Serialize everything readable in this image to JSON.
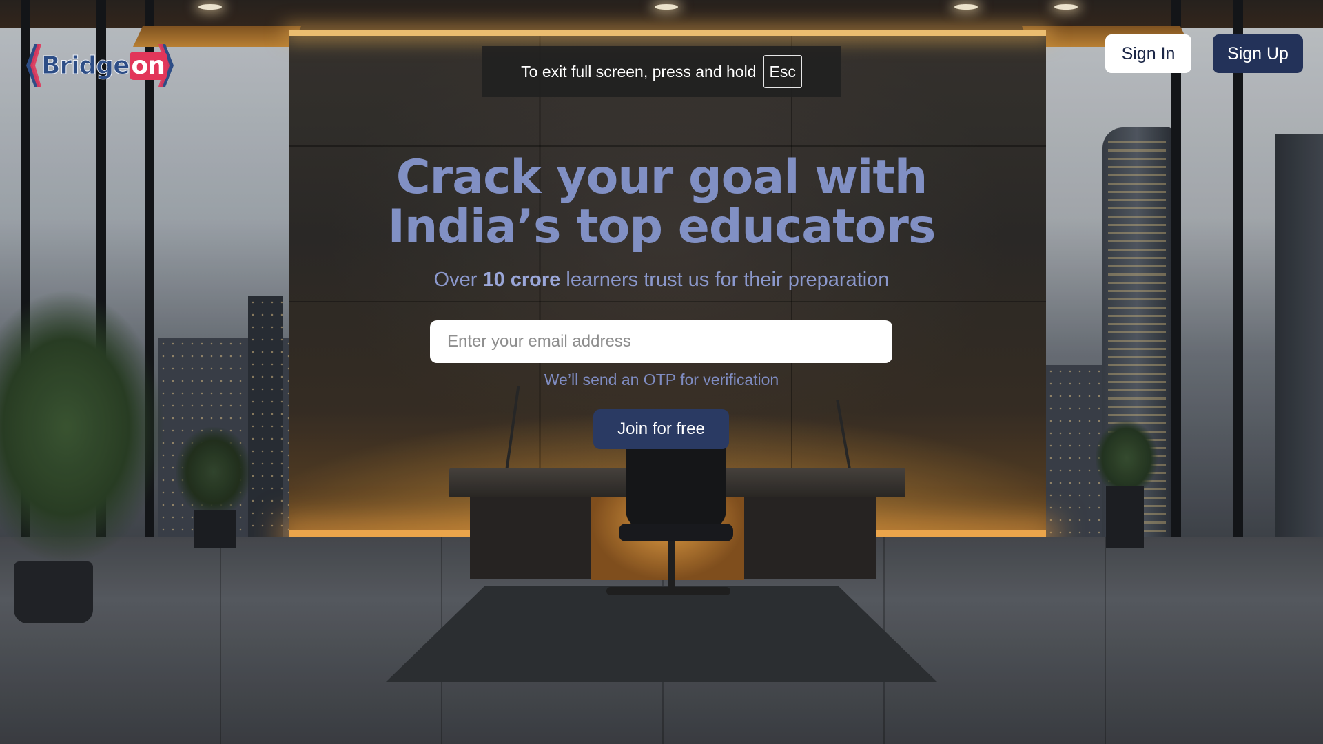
{
  "logo": {
    "word_main": "Bridge",
    "word_accent": "on"
  },
  "fullscreen_notice": {
    "text": "To exit full screen, press and hold",
    "key": "Esc"
  },
  "header": {
    "sign_in_label": "Sign In",
    "sign_up_label": "Sign Up"
  },
  "hero": {
    "title_line1": "Crack your goal with",
    "title_line2": "India’s top educators",
    "subtitle_prefix": "Over ",
    "subtitle_bold": "10 crore",
    "subtitle_suffix": " learners trust us for their preparation"
  },
  "signup_form": {
    "email_placeholder": "Enter your email address",
    "email_value": "",
    "otp_note": "We’ll send an OTP for verification",
    "join_label": "Join for free"
  },
  "colors": {
    "accent_navy": "#233259",
    "logo_blue": "#2d4d86",
    "logo_pink": "#e2365a",
    "hero_text": "#8190c4"
  },
  "icons": {
    "logo_chevrons": "bracket-chevron-icon"
  }
}
